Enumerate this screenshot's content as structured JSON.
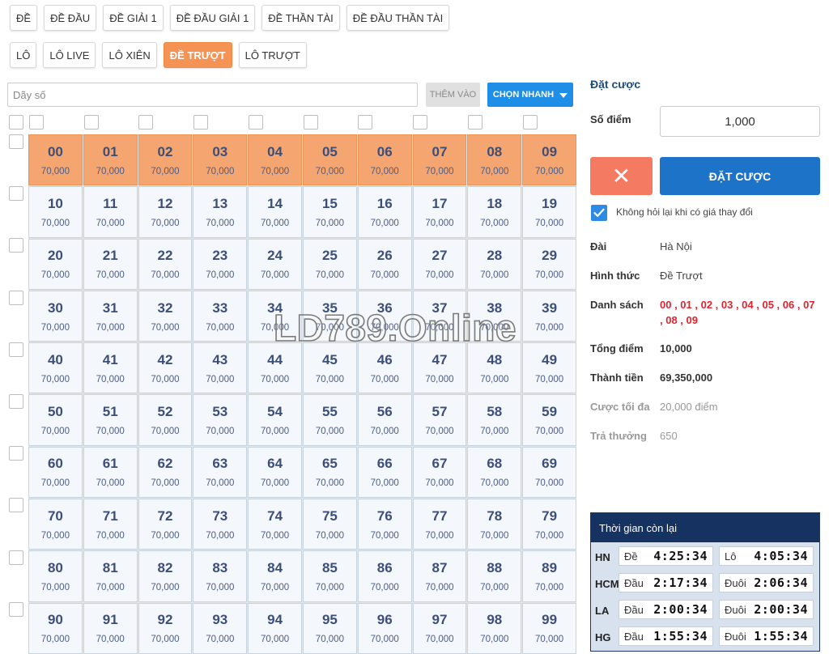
{
  "tabs_row1": [
    "ĐỀ",
    "ĐỀ ĐẦU",
    "ĐỀ GIẢI 1",
    "ĐỀ ĐẦU GIẢI 1",
    "ĐỀ THẦN TÀI",
    "ĐỀ ĐẦU THẦN TÀI"
  ],
  "tabs_row2": [
    "LÔ",
    "LÔ LIVE",
    "LÔ XIÊN",
    "ĐỀ TRƯỢT",
    "LÔ TRƯỢT"
  ],
  "active_tab": "ĐỀ TRƯỢT",
  "input": {
    "placeholder": "Dãy số",
    "add_label": "THÊM VÀO",
    "quick_label": "CHỌN NHANH"
  },
  "grid": {
    "price": "70,000",
    "selected": [
      "00",
      "01",
      "02",
      "03",
      "04",
      "05",
      "06",
      "07",
      "08",
      "09"
    ]
  },
  "bet": {
    "title": "Đặt cược",
    "points_label": "Số điểm",
    "points_value": "1,000",
    "cancel_symbol": "✕",
    "submit_label": "ĐẶT CƯỢC",
    "no_ask_label": "Không hỏi lại khi có giá thay đổi",
    "station_label": "Đài",
    "station_value": "Hà Nội",
    "type_label": "Hình thức",
    "type_value": "Đề Trượt",
    "list_label": "Danh sách",
    "list_line1": "00 , 01 , 02 , 03 , 04 , 05 , 06 , 07",
    "list_line2": ", 08 , 09",
    "total_label": "Tổng điểm",
    "total_value": "10,000",
    "amount_label": "Thành tiền",
    "amount_value": "69,350,000",
    "max_label": "Cược tối đa",
    "max_value": "20,000 điểm",
    "payout_label": "Trả thưởng",
    "payout_value": "650"
  },
  "timer": {
    "title": "Thời gian còn lại",
    "rows": [
      {
        "region": "HN",
        "k1": "Đề",
        "t1": "4:25:34",
        "k2": "Lô",
        "t2": "4:05:34"
      },
      {
        "region": "HCM",
        "k1": "Đầu",
        "t1": "2:17:34",
        "k2": "Đuôi",
        "t2": "2:06:34"
      },
      {
        "region": "LA",
        "k1": "Đầu",
        "t1": "2:00:34",
        "k2": "Đuôi",
        "t2": "2:00:34"
      },
      {
        "region": "HG",
        "k1": "Đầu",
        "t1": "1:55:34",
        "k2": "Đuôi",
        "t2": "1:55:34"
      }
    ]
  },
  "watermark": "LD789.Online",
  "colors": {
    "accent": "#f49353",
    "primary": "#1d73c8",
    "danger": "#f47a62",
    "list_red": "#e0232f"
  }
}
